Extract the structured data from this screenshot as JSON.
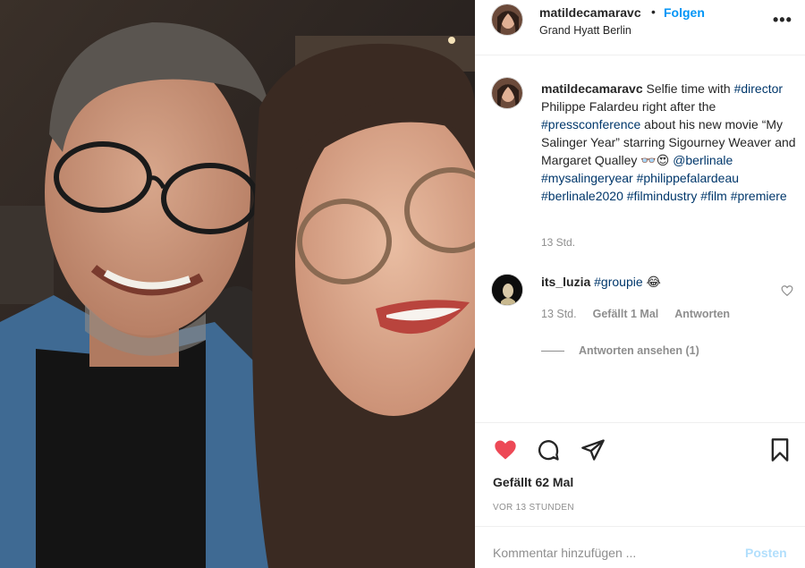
{
  "post": {
    "username": "matildecamaravc",
    "dot": "•",
    "follow_label": "Folgen",
    "location": "Grand Hyatt Berlin",
    "more_icon": "more-horizontal-icon"
  },
  "caption": {
    "username": "matildecamaravc",
    "parts": [
      {
        "t": "text",
        "v": " Selfie time with "
      },
      {
        "t": "tag",
        "v": "#director"
      },
      {
        "t": "text",
        "v": " Philippe Falardeu right after the "
      },
      {
        "t": "tag",
        "v": "#pressconference"
      },
      {
        "t": "text",
        "v": " about his new movie “My Salinger Year” starring Sigourney Weaver and Margaret Qualley 👓😍 "
      },
      {
        "t": "tag",
        "v": "@berlinale"
      },
      {
        "t": "text",
        "v": " "
      },
      {
        "t": "tag",
        "v": "#mysalingeryear"
      },
      {
        "t": "text",
        "v": " "
      },
      {
        "t": "tag",
        "v": "#philippefalardeau"
      },
      {
        "t": "text",
        "v": " "
      },
      {
        "t": "tag",
        "v": "#berlinale2020"
      },
      {
        "t": "text",
        "v": " "
      },
      {
        "t": "tag",
        "v": "#filmindustry"
      },
      {
        "t": "text",
        "v": " "
      },
      {
        "t": "tag",
        "v": "#film"
      },
      {
        "t": "text",
        "v": " "
      },
      {
        "t": "tag",
        "v": "#premiere"
      }
    ],
    "time": "13 Std."
  },
  "reply": {
    "username": "its_luzia",
    "hashtag": "#groupie",
    "emoji": "😂",
    "time": "13 Std.",
    "likes": "Gefällt 1 Mal",
    "reply_label": "Antworten",
    "view_replies": "Antworten ansehen (1)"
  },
  "actions": {
    "likes_text": "Gefällt 62 Mal",
    "time_ago": "VOR 13 STUNDEN",
    "like_color": "#ed4956"
  },
  "comment_box": {
    "placeholder": "Kommentar hinzufügen ...",
    "post_label": "Posten"
  }
}
